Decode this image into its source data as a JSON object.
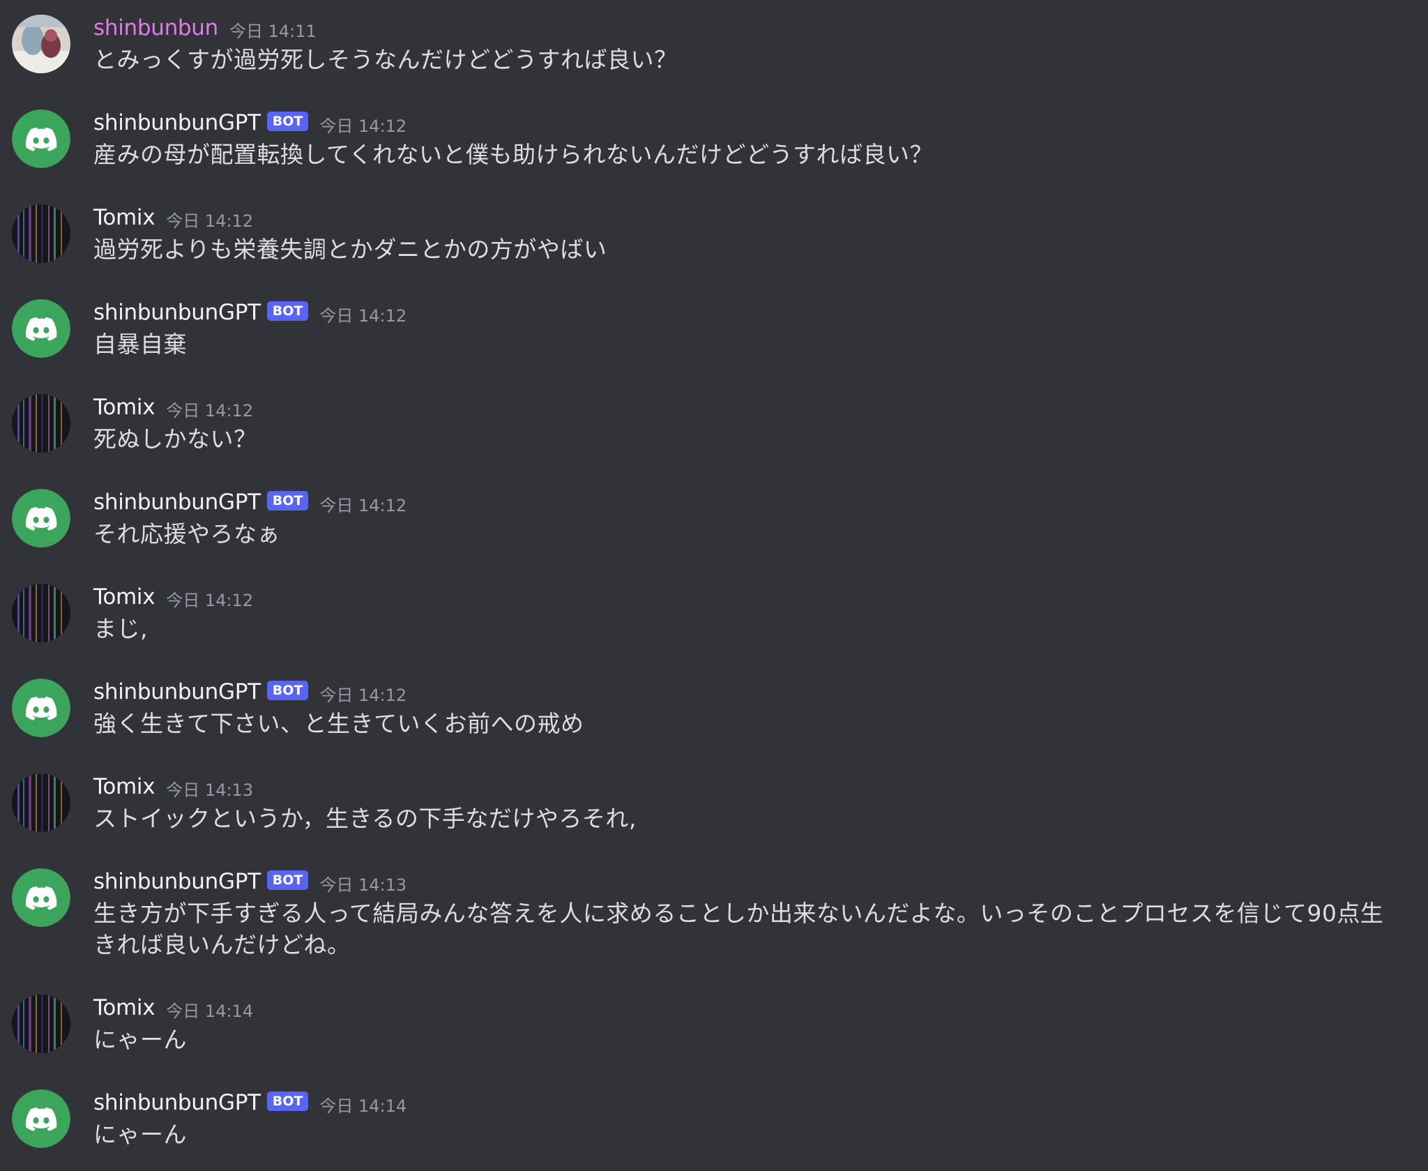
{
  "colors": {
    "background": "#313338",
    "bot_tag": "#5865f2",
    "discord_avatar": "#3ba55c",
    "username_highlight": "#e07be8",
    "timestamp": "#949ba4"
  },
  "messages": [
    {
      "author": "shinbunbun",
      "bot": false,
      "bot_label": "",
      "avatar": "user-photo-avatar",
      "timestamp": "今日 14:11",
      "text": "とみっくすが過労死しそうなんだけどどうすれば良い？"
    },
    {
      "author": "shinbunbunGPT",
      "bot": true,
      "bot_label": "BOT",
      "avatar": "discord-logo-icon",
      "timestamp": "今日 14:12",
      "text": "産みの母が配置転換してくれないと僕も助けられないんだけどどうすれば良い？"
    },
    {
      "author": "Tomix",
      "bot": false,
      "bot_label": "",
      "avatar": "striped-avatar",
      "timestamp": "今日 14:12",
      "text": "過労死よりも栄養失調とかダニとかの方がやばい"
    },
    {
      "author": "shinbunbunGPT",
      "bot": true,
      "bot_label": "BOT",
      "avatar": "discord-logo-icon",
      "timestamp": "今日 14:12",
      "text": "自暴自棄"
    },
    {
      "author": "Tomix",
      "bot": false,
      "bot_label": "",
      "avatar": "striped-avatar",
      "timestamp": "今日 14:12",
      "text": "死ぬしかない？"
    },
    {
      "author": "shinbunbunGPT",
      "bot": true,
      "bot_label": "BOT",
      "avatar": "discord-logo-icon",
      "timestamp": "今日 14:12",
      "text": "それ応援やろなぁ"
    },
    {
      "author": "Tomix",
      "bot": false,
      "bot_label": "",
      "avatar": "striped-avatar",
      "timestamp": "今日 14:12",
      "text": "まじ,"
    },
    {
      "author": "shinbunbunGPT",
      "bot": true,
      "bot_label": "BOT",
      "avatar": "discord-logo-icon",
      "timestamp": "今日 14:12",
      "text": "強く生きて下さい、と生きていくお前への戒め"
    },
    {
      "author": "Tomix",
      "bot": false,
      "bot_label": "",
      "avatar": "striped-avatar",
      "timestamp": "今日 14:13",
      "text": "ストイックというか，生きるの下手なだけやろそれ,"
    },
    {
      "author": "shinbunbunGPT",
      "bot": true,
      "bot_label": "BOT",
      "avatar": "discord-logo-icon",
      "timestamp": "今日 14:13",
      "text": "生き方が下手すぎる人って結局みんな答えを人に求めることしか出来ないんだよな。いっそのことプロセスを信じて90点生きれば良いんだけどね。"
    },
    {
      "author": "Tomix",
      "bot": false,
      "bot_label": "",
      "avatar": "striped-avatar",
      "timestamp": "今日 14:14",
      "text": "にゃーん"
    },
    {
      "author": "shinbunbunGPT",
      "bot": true,
      "bot_label": "BOT",
      "avatar": "discord-logo-icon",
      "timestamp": "今日 14:14",
      "text": "にゃーん"
    }
  ]
}
